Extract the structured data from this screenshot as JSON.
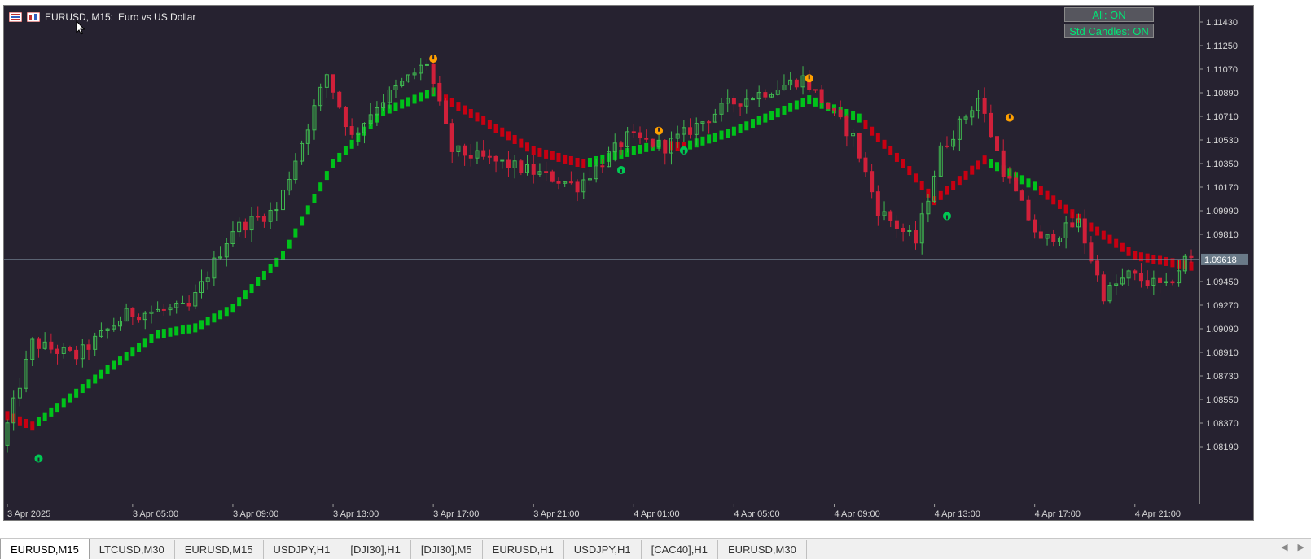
{
  "window": {
    "symbol_title": "EURUSD, M15:",
    "description": "Euro vs US Dollar"
  },
  "buttons": {
    "all_label": "All: ON",
    "std_candles_label": "Std Candles: ON"
  },
  "colors": {
    "background": "#262230",
    "bull_candle": "#3fb950",
    "bear_candle": "#d0203a",
    "trend_up": "#00c21a",
    "trend_down": "#c80012",
    "signal_up": "#00c853",
    "signal_down": "#ffa000",
    "current_price_line": "#7a8a99"
  },
  "price_axis": {
    "labels": [
      "1.11430",
      "1.11250",
      "1.11070",
      "1.10890",
      "1.10710",
      "1.10530",
      "1.10350",
      "1.10170",
      "1.09990",
      "1.09810",
      "1.09450",
      "1.09270",
      "1.09090",
      "1.08910",
      "1.08730",
      "1.08550",
      "1.08370",
      "1.08190"
    ],
    "current_price": "1.09618"
  },
  "time_axis": {
    "labels": [
      "3 Apr 2025",
      "3 Apr 05:00",
      "3 Apr 09:00",
      "3 Apr 13:00",
      "3 Apr 17:00",
      "3 Apr 21:00",
      "4 Apr 01:00",
      "4 Apr 05:00",
      "4 Apr 09:00",
      "4 Apr 13:00",
      "4 Apr 17:00",
      "4 Apr 21:00"
    ]
  },
  "tabs": [
    {
      "label": "EURUSD,M15",
      "active": true
    },
    {
      "label": "LTCUSD,M30",
      "active": false
    },
    {
      "label": "EURUSD,M15",
      "active": false
    },
    {
      "label": "USDJPY,H1",
      "active": false
    },
    {
      "label": "[DJI30],H1",
      "active": false
    },
    {
      "label": "[DJI30],M5",
      "active": false
    },
    {
      "label": "EURUSD,H1",
      "active": false
    },
    {
      "label": "USDJPY,H1",
      "active": false
    },
    {
      "label": "[CAC40],H1",
      "active": false
    },
    {
      "label": "EURUSD,M30",
      "active": false
    }
  ],
  "chart_data": {
    "type": "candlestick",
    "title": "EURUSD, M15: Euro vs US Dollar",
    "symbol": "EURUSD",
    "timeframe": "M15",
    "y_range": [
      1.081,
      1.1152
    ],
    "x_range": [
      "3 Apr 00:00",
      "4 Apr 23:15"
    ],
    "current_price": 1.09618,
    "grid": false,
    "price_path_keypoints": [
      {
        "t": "3 Apr 00:00",
        "price": 1.082
      },
      {
        "t": "3 Apr 01:15",
        "price": 1.0898
      },
      {
        "t": "3 Apr 03:00",
        "price": 1.0888
      },
      {
        "t": "3 Apr 05:00",
        "price": 1.092
      },
      {
        "t": "3 Apr 07:30",
        "price": 1.0925
      },
      {
        "t": "3 Apr 09:15",
        "price": 1.0985
      },
      {
        "t": "3 Apr 11:00",
        "price": 1.1
      },
      {
        "t": "3 Apr 13:00",
        "price": 1.1103
      },
      {
        "t": "3 Apr 14:00",
        "price": 1.1055
      },
      {
        "t": "3 Apr 15:00",
        "price": 1.108
      },
      {
        "t": "3 Apr 17:00",
        "price": 1.1112
      },
      {
        "t": "3 Apr 18:00",
        "price": 1.1045
      },
      {
        "t": "3 Apr 21:00",
        "price": 1.103
      },
      {
        "t": "3 Apr 23:00",
        "price": 1.1018
      },
      {
        "t": "4 Apr 01:00",
        "price": 1.1055
      },
      {
        "t": "4 Apr 02:30",
        "price": 1.1048
      },
      {
        "t": "4 Apr 05:00",
        "price": 1.108
      },
      {
        "t": "4 Apr 08:00",
        "price": 1.11
      },
      {
        "t": "4 Apr 10:00",
        "price": 1.1055
      },
      {
        "t": "4 Apr 11:00",
        "price": 1.1
      },
      {
        "t": "4 Apr 12:30",
        "price": 1.0975
      },
      {
        "t": "4 Apr 13:30",
        "price": 1.1045
      },
      {
        "t": "4 Apr 15:00",
        "price": 1.1085
      },
      {
        "t": "4 Apr 16:00",
        "price": 1.103
      },
      {
        "t": "4 Apr 17:30",
        "price": 1.0975
      },
      {
        "t": "4 Apr 19:00",
        "price": 1.099
      },
      {
        "t": "4 Apr 20:00",
        "price": 1.0935
      },
      {
        "t": "4 Apr 21:00",
        "price": 1.095
      },
      {
        "t": "4 Apr 22:30",
        "price": 1.094
      },
      {
        "t": "4 Apr 23:15",
        "price": 1.0962
      }
    ],
    "trend_line_keypoints": [
      {
        "t": "3 Apr 00:00",
        "price": 1.0843,
        "state": "down"
      },
      {
        "t": "3 Apr 01:00",
        "price": 1.0835,
        "state": "up"
      },
      {
        "t": "3 Apr 04:00",
        "price": 1.0878,
        "state": "up"
      },
      {
        "t": "3 Apr 06:00",
        "price": 1.0905,
        "state": "up"
      },
      {
        "t": "3 Apr 07:30",
        "price": 1.091,
        "state": "up"
      },
      {
        "t": "3 Apr 09:00",
        "price": 1.0925,
        "state": "up"
      },
      {
        "t": "3 Apr 11:00",
        "price": 1.0965,
        "state": "up"
      },
      {
        "t": "3 Apr 13:00",
        "price": 1.1035,
        "state": "up"
      },
      {
        "t": "3 Apr 15:00",
        "price": 1.1075,
        "state": "up"
      },
      {
        "t": "3 Apr 17:00",
        "price": 1.109,
        "state": "down"
      },
      {
        "t": "3 Apr 19:00",
        "price": 1.1068,
        "state": "down"
      },
      {
        "t": "3 Apr 21:00",
        "price": 1.1045,
        "state": "down"
      },
      {
        "t": "3 Apr 23:00",
        "price": 1.1035,
        "state": "up"
      },
      {
        "t": "4 Apr 01:00",
        "price": 1.1045,
        "state": "up"
      },
      {
        "t": "4 Apr 02:00",
        "price": 1.105,
        "state": "down"
      },
      {
        "t": "4 Apr 03:00",
        "price": 1.1048,
        "state": "up"
      },
      {
        "t": "4 Apr 05:00",
        "price": 1.106,
        "state": "up"
      },
      {
        "t": "4 Apr 08:00",
        "price": 1.1084,
        "state": "up"
      },
      {
        "t": "4 Apr 10:00",
        "price": 1.107,
        "state": "down"
      },
      {
        "t": "4 Apr 12:00",
        "price": 1.103,
        "state": "down"
      },
      {
        "t": "4 Apr 13:00",
        "price": 1.1007,
        "state": "down"
      },
      {
        "t": "4 Apr 15:00",
        "price": 1.1038,
        "state": "up"
      },
      {
        "t": "4 Apr 17:00",
        "price": 1.1018,
        "state": "down"
      },
      {
        "t": "4 Apr 19:00",
        "price": 1.099,
        "state": "down"
      },
      {
        "t": "4 Apr 21:00",
        "price": 1.0965,
        "state": "down"
      },
      {
        "t": "4 Apr 23:15",
        "price": 1.0957,
        "state": "down"
      }
    ],
    "signals": [
      {
        "t": "3 Apr 01:15",
        "price": 1.081,
        "type": "buy"
      },
      {
        "t": "3 Apr 17:00",
        "price": 1.1115,
        "type": "sell"
      },
      {
        "t": "4 Apr 00:30",
        "price": 1.103,
        "type": "buy"
      },
      {
        "t": "4 Apr 02:00",
        "price": 1.106,
        "type": "sell"
      },
      {
        "t": "4 Apr 03:00",
        "price": 1.1045,
        "type": "buy"
      },
      {
        "t": "4 Apr 08:00",
        "price": 1.11,
        "type": "sell"
      },
      {
        "t": "4 Apr 13:30",
        "price": 1.0995,
        "type": "buy"
      },
      {
        "t": "4 Apr 16:00",
        "price": 1.107,
        "type": "sell"
      }
    ]
  }
}
